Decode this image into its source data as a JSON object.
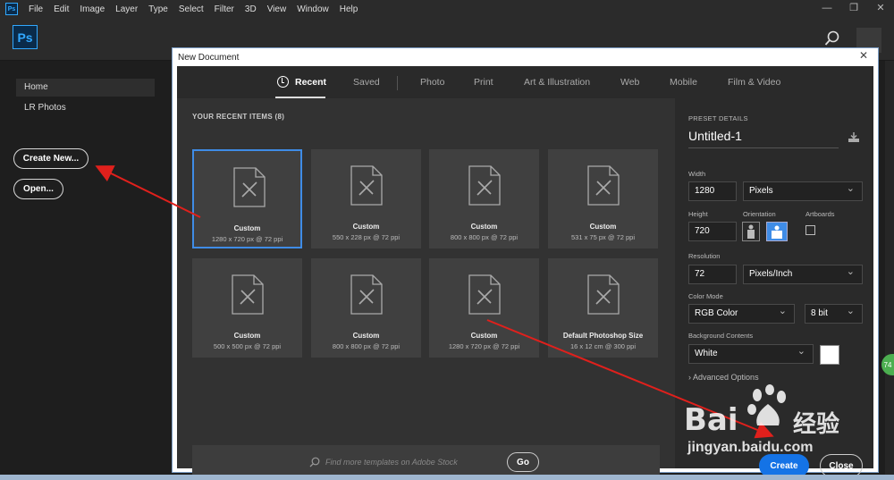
{
  "menubar": {
    "items": [
      "File",
      "Edit",
      "Image",
      "Layer",
      "Type",
      "Select",
      "Filter",
      "3D",
      "View",
      "Window",
      "Help"
    ]
  },
  "app": {
    "logo": "Ps",
    "icons": [
      "search-icon"
    ]
  },
  "sidebar": {
    "items": [
      {
        "label": "Home"
      },
      {
        "label": "LR Photos"
      }
    ],
    "create_new": "Create New...",
    "open": "Open..."
  },
  "dialog": {
    "title": "New Document",
    "close_glyph": "✕",
    "tabs": [
      "Recent",
      "Saved",
      "Photo",
      "Print",
      "Art & Illustration",
      "Web",
      "Mobile",
      "Film & Video"
    ],
    "recent_label": "YOUR RECENT ITEMS",
    "recent_count": "(8)",
    "recent_items": [
      {
        "title": "Custom",
        "size": "1280 x 720 px @ 72 ppi"
      },
      {
        "title": "Custom",
        "size": "550 x 228 px @ 72 ppi"
      },
      {
        "title": "Custom",
        "size": "800 x 800 px @ 72 ppi"
      },
      {
        "title": "Custom",
        "size": "531 x 75 px @ 72 ppi"
      },
      {
        "title": "Custom",
        "size": "500 x 500 px @ 72 ppi"
      },
      {
        "title": "Custom",
        "size": "800 x 800 px @ 72 ppi"
      },
      {
        "title": "Custom",
        "size": "1280 x 720 px @ 72 ppi"
      },
      {
        "title": "Default Photoshop Size",
        "size": "16 x 12 cm @ 300 ppi"
      }
    ],
    "search_placeholder": "Find more templates on Adobe Stock",
    "go": "Go"
  },
  "preset": {
    "heading": "PRESET DETAILS",
    "name": "Untitled-1",
    "width_label": "Width",
    "width": "1280",
    "width_unit": "Pixels",
    "height_label": "Height",
    "height": "720",
    "orientation_label": "Orientation",
    "artboards_label": "Artboards",
    "resolution_label": "Resolution",
    "resolution": "72",
    "resolution_unit": "Pixels/Inch",
    "color_mode_label": "Color Mode",
    "color_mode": "RGB Color",
    "bit_depth": "8 bit",
    "bg_label": "Background Contents",
    "bg": "White",
    "advanced": "Advanced Options",
    "create": "Create",
    "close": "Close"
  },
  "badge": "74",
  "watermark": {
    "bai": "Bai",
    "cn": "经验",
    "url": "jingyan.baidu.com"
  },
  "colors": {
    "accent": "#1473e6",
    "selection": "#3f8ce6",
    "annotation": "#e0201c"
  }
}
